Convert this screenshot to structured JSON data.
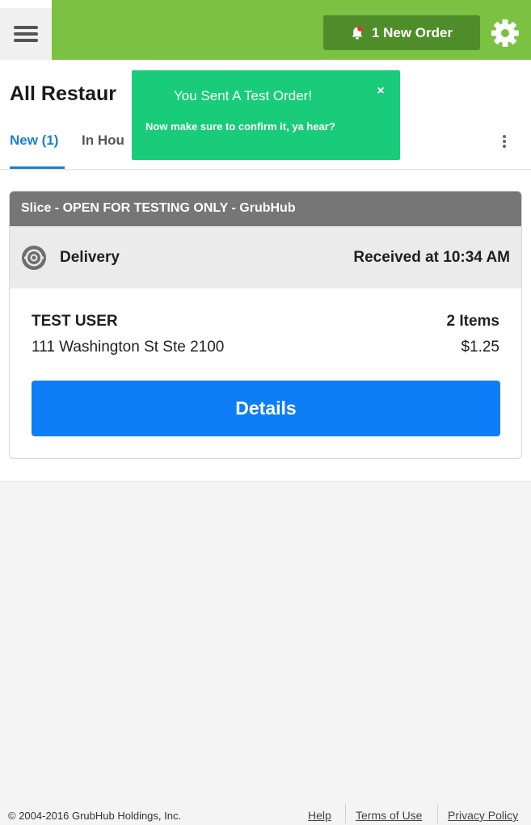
{
  "topbar": {
    "new_order_label": "1 New Order",
    "accent_color": "#7bc142",
    "button_color": "#4f8d2b",
    "bell_dot_color": "#e8312f"
  },
  "header": {
    "title": "All Restaur",
    "tabs": [
      {
        "label": "New (1)",
        "active": true
      },
      {
        "label": "In Hou",
        "active": false
      }
    ]
  },
  "toast": {
    "title": "You Sent A Test Order!",
    "message": "Now make sure to confirm it, ya hear?",
    "close_label": "×",
    "color": "#18cc79"
  },
  "order_card": {
    "restaurant": "Slice - OPEN FOR TESTING ONLY - GrubHub",
    "type": "Delivery",
    "received": "Received at 10:34 AM",
    "customer": "TEST USER",
    "address": "111 Washington St Ste 2100",
    "item_count": "2 Items",
    "total": "$1.25",
    "details_label": "Details",
    "details_color": "#0d7ef6"
  },
  "footer": {
    "copyright": "© 2004-2016 GrubHub Holdings, Inc.",
    "links": [
      "Help",
      "Terms of Use",
      "Privacy Policy"
    ]
  }
}
